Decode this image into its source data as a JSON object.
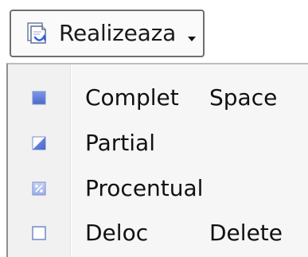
{
  "button": {
    "label": "Realizeaza",
    "icon": "document-check-icon",
    "caret": "caret-down-icon"
  },
  "menu": {
    "items": [
      {
        "label": "Complet",
        "shortcut": "Space",
        "icon": "status-complete-icon"
      },
      {
        "label": "Partial",
        "shortcut": "",
        "icon": "status-partial-icon"
      },
      {
        "label": "Procentual",
        "shortcut": "",
        "icon": "status-percent-icon"
      },
      {
        "label": "Deloc",
        "shortcut": "Delete",
        "icon": "status-empty-icon"
      }
    ]
  },
  "colors": {
    "icon_blue": "#5b7bd8",
    "icon_light_blue": "#b8c7f2",
    "icon_border": "#7b8fcc"
  }
}
